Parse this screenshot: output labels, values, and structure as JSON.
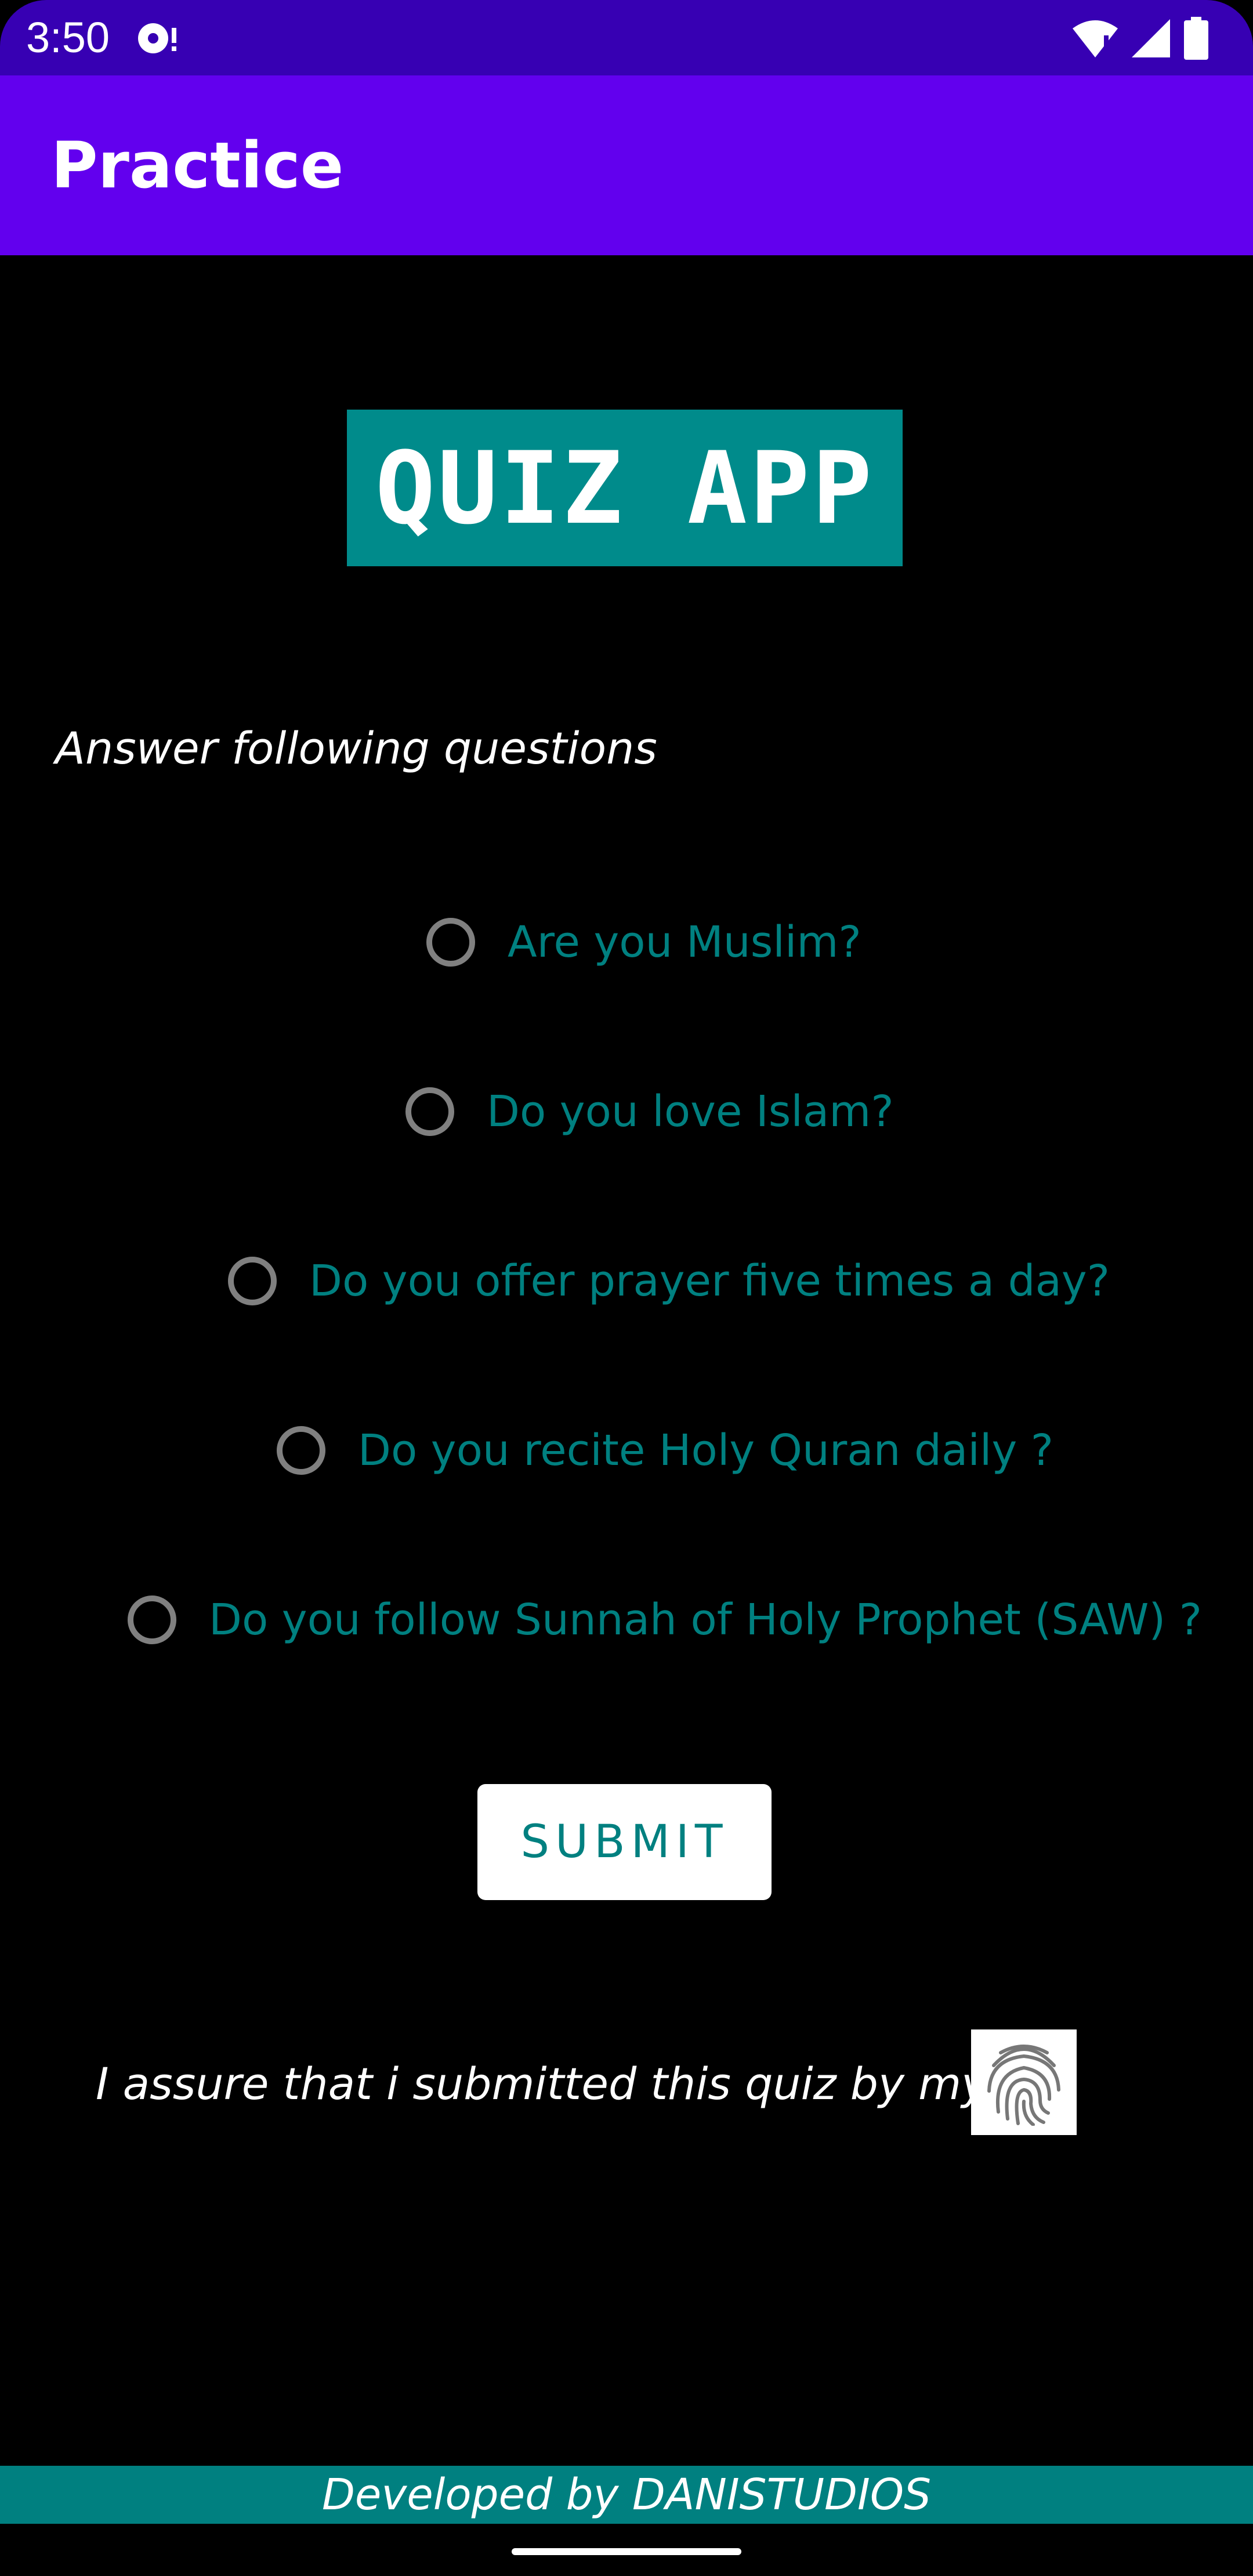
{
  "status_bar": {
    "time": "3:50",
    "icons": [
      "media-notification-icon",
      "wifi-icon",
      "signal-icon",
      "battery-icon"
    ]
  },
  "app_bar": {
    "title": "Practice"
  },
  "banner": {
    "title": "QUIZ APP"
  },
  "intro": "Answer following questions",
  "questions": [
    {
      "label": "Are you Muslim?",
      "checked": false
    },
    {
      "label": "Do you love Islam?",
      "checked": false
    },
    {
      "label": "Do you offer prayer five times a day?",
      "checked": false
    },
    {
      "label": "Do you recite Holy Quran daily ?",
      "checked": false
    },
    {
      "label": "Do you follow Sunnah of Holy Prophet (SAW) ?",
      "checked": false
    }
  ],
  "submit_label": "SUBMIT",
  "assurance": {
    "text": "I assure that i submitted this quiz by myself",
    "icon": "fingerprint-icon"
  },
  "footer": "Developed by DANISTUDIOS",
  "colors": {
    "status_bar": "#3700b3",
    "app_bar": "#6200ee",
    "accent_teal": "#008b8b",
    "question_text": "#008080",
    "background": "#000000"
  }
}
